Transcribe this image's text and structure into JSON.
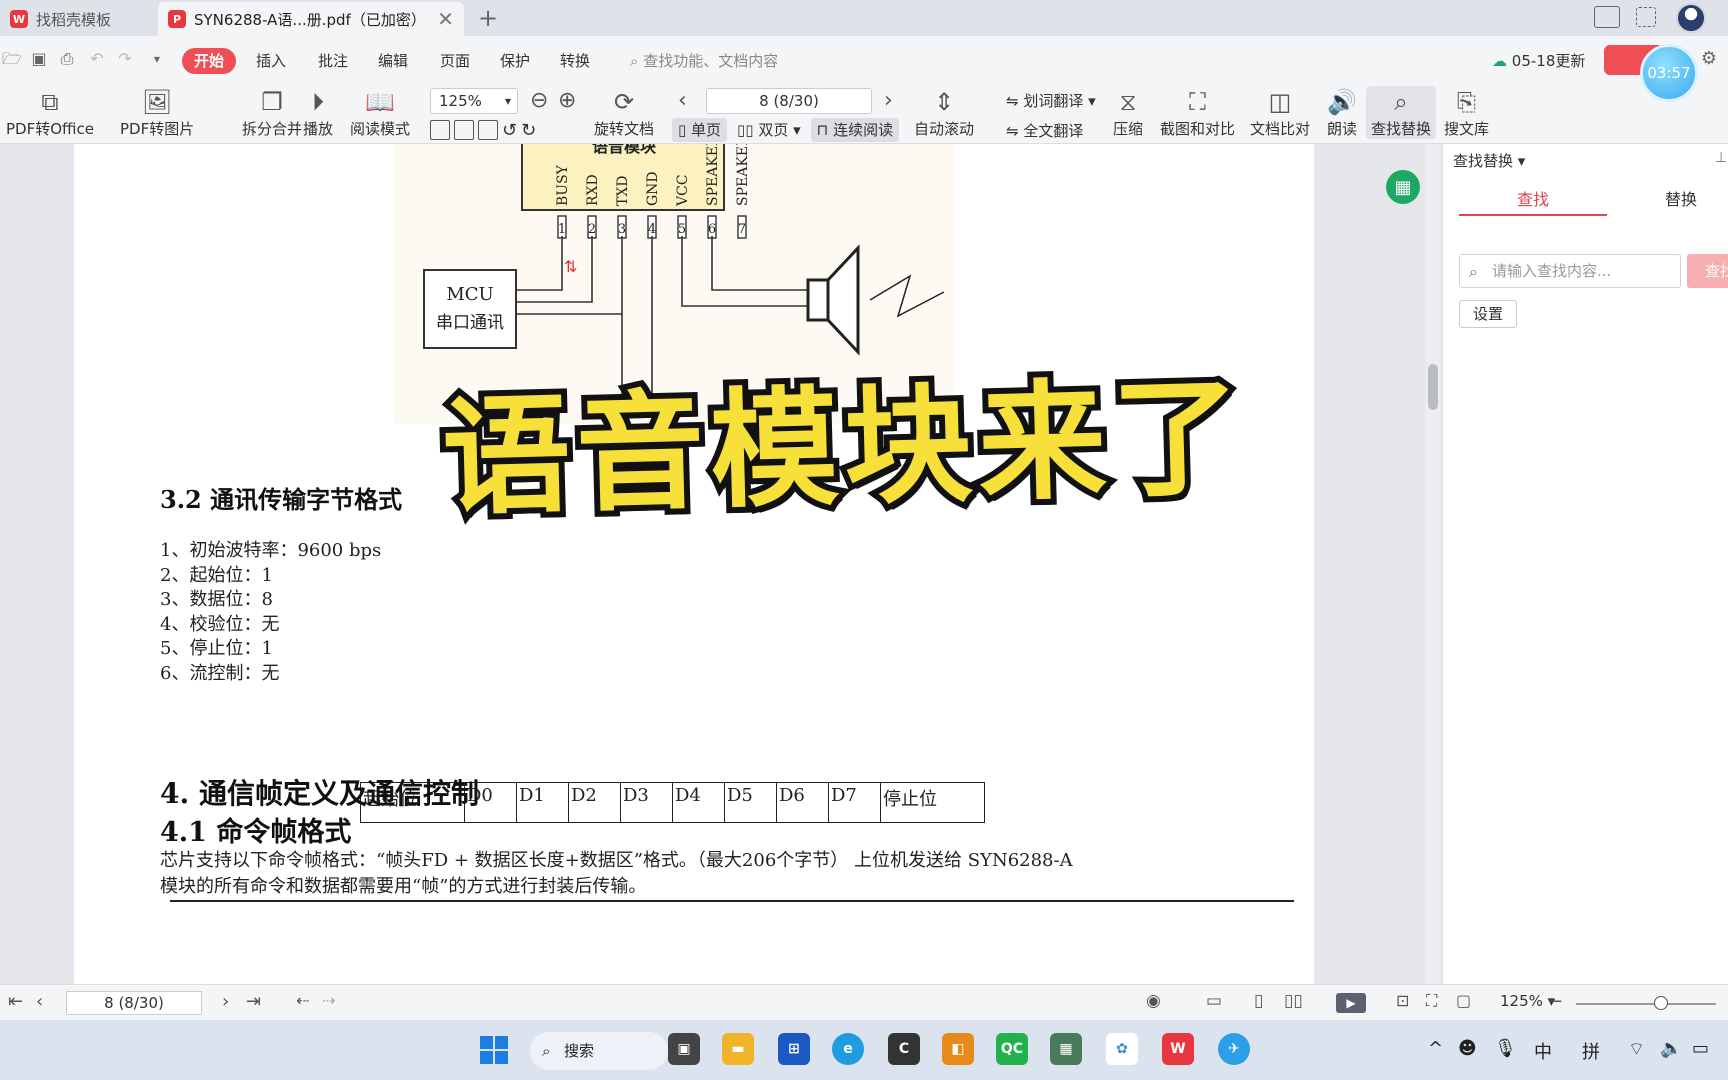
{
  "tabs": [
    {
      "label": "找稻壳模板",
      "logo_color": "#e8373e"
    },
    {
      "label": "SYN6288-A语...册.pdf（已加密）",
      "logo_color": "#e8373e"
    }
  ],
  "menu": {
    "items": [
      "开始",
      "插入",
      "批注",
      "编辑",
      "页面",
      "保护",
      "转换"
    ],
    "active": "开始",
    "search_placeholder": "查找功能、文档内容",
    "update_label": "05-18更新",
    "timer": "03:57"
  },
  "ribbon": {
    "pdf_to_office": "PDF转Office",
    "pdf_to_image": "PDF转图片",
    "split_merge": "拆分合并",
    "play": "播放",
    "read_mode": "阅读模式",
    "zoom": "125%",
    "rotate": "旋转文档",
    "page_indicator": "8 (8/30)",
    "single_page": "单页",
    "double_page": "双页",
    "continuous": "连续阅读",
    "auto_scroll": "自动滚动",
    "word_translate": "划词翻译",
    "full_translate": "全文翻译",
    "compress": "压缩",
    "screenshot_compare": "截图和对比",
    "doc_compare": "文档比对",
    "read_aloud": "朗读",
    "find_replace": "查找替换",
    "search_library": "搜文库"
  },
  "document": {
    "diagram": {
      "module_title": "语音模块",
      "pins": [
        "BUSY",
        "RXD",
        "TXD",
        "GND",
        "VCC",
        "SPEAKER",
        "SPEAKER"
      ],
      "pin_numbers": [
        "1",
        "2",
        "3",
        "4",
        "5",
        "6",
        "7"
      ],
      "mcu_label": "MCU",
      "mcu_sub": "串口通讯"
    },
    "overlay_title": "语音模块来了",
    "section_32": "3.2 通讯传输字节格式",
    "params": [
      "1、初始波特率：9600 bps",
      "2、起始位：1",
      "3、数据位：8",
      "4、校验位：无",
      "5、停止位：1",
      "6、流控制：无"
    ],
    "byte_table": [
      "起始位",
      "D0",
      "D1",
      "D2",
      "D3",
      "D4",
      "D5",
      "D6",
      "D7",
      "停止位"
    ],
    "section_4": "4. 通信帧定义及通信控制",
    "section_41": "4.1 命令帧格式",
    "para_line1": "芯片支持以下命令帧格式：“帧头FD + 数据区长度+数据区”格式。（最大206个字节） 上位机发送给 SYN6288-A",
    "para_line2": "模块的所有命令和数据都需要用“帧”的方式进行封装后传输。"
  },
  "sidebar": {
    "title": "查找替换",
    "tab_find": "查找",
    "tab_replace": "替换",
    "search_placeholder": "请输入查找内容...",
    "find_button": "查找",
    "settings": "设置"
  },
  "status": {
    "page": "8 (8/30)",
    "zoom": "125%"
  },
  "taskbar": {
    "search": "搜索",
    "ime": "中",
    "ime2": "拼"
  }
}
